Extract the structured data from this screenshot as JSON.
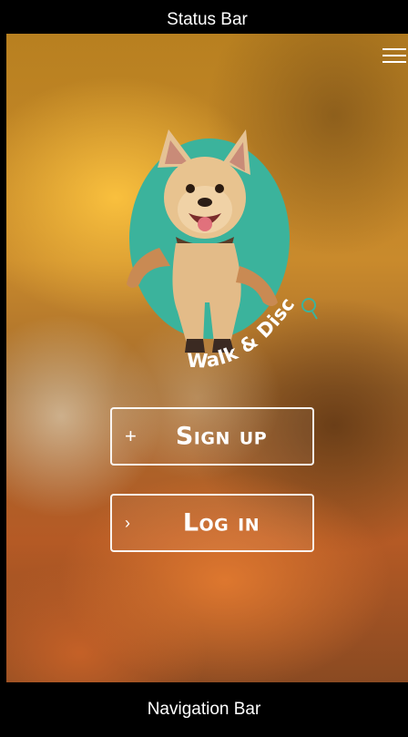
{
  "status_bar": {
    "label": "Status Bar"
  },
  "navigation_bar": {
    "label": "Navigation Bar"
  },
  "header": {
    "menu_icon": "hamburger-menu-icon"
  },
  "logo": {
    "text": "Walk & Discover",
    "badge_color": "#3bb39c",
    "icon": "paw-pin-icon"
  },
  "actions": {
    "signup": {
      "icon": "+",
      "label": "Sign up"
    },
    "login": {
      "icon": "›",
      "label": "Log in"
    }
  },
  "colors": {
    "button_border": "#ffffff",
    "logo_teal": "#3bb39c"
  }
}
